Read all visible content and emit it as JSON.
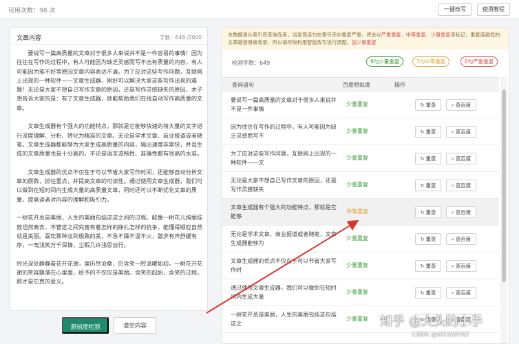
{
  "topbar": {
    "remaining": "可用次数：98 次",
    "rewrite": "一键改写",
    "tutorial": "使用教程"
  },
  "left": {
    "title": "文章内容",
    "count": "字数：649 /2000",
    "paragraphs": [
      "要说写一篇高质量的文章对于很多人来说并不是一件容易的事情！因为往往在写作的过程中，有人可能因为缺乏灵感而写不出有质量的内容，有人可能因为笔不好等原因文章内容表达不清。为了应对这些写作问题，互联网上出现的一种软件——文章生成器，刚好可以解决大家这些写作出现的难题！无论是大家不想自己写作文章的原因，还是写作灵感缺失的原因，木子想告诉大家的是：有了文章生成器，就能帮助我们在线自动写作高质量的文章。",
      "文章生成器有个强大的功能特点，那就是它能够快速的将大量的文字进行深度理解、分析、转化为精准的文章。无论是学术文章、商业报道或者随笔，文章生成器都能够为大家生成高质量的内容，输出速度非常快，并且生成的文章质量也是十分高的，不论是语言流畅性、准确性都有很高的水准。",
      "文章生成器的优点不仅在于可以节省大家写作时间，还能够自动分析文章的原数，抓住重点，并提高文章的可读性。通过使用文章生成器，我们可以做到在短时间内生成大量的高质量文章，同时还可以不断优化文章的质量，提高读者对内容的理解和吸引力。",
      "一树花开总是美丽，人生的美丽包括这这之间的过程。能像一树花儿绚丽绽放坦然离去，不管这之间究竟有着怎样的挣扎怎样的抗争，能懂得顺应自然就是美丽。喜欢那种淡到极致的美，不急不躁不温不火，散步有声舒缓有序，一弯浅笑万千深情，尘暇几许浅思淡行。",
      "时光深处静静看花开花谢，里历尽沧桑，仍含笑一腔温暖如初。一树花开花谢的笑容飘落在心里面，给予的不仅仅是美丽。含笑的起始，含笑的过程，那才是它真的意义。"
    ],
    "detect_btn": "原创度检测",
    "clear_btn": "清空内容"
  },
  "right": {
    "notice_pre": "本数据是从索引库查询而来，当发现该句在索引库中重复严重，将会以",
    "notice_hl1": "严重重复、中等重复、少量重复",
    "notice_post": "来标记，重复度越低的文章越容易被收录，所以请尽快利用智能改写进行调整。",
    "notice_link": "加少量重复",
    "detect_count": "检测字数：649",
    "pill_green": "9句少量重复",
    "pill_orange": "3句中等重复",
    "pill_red": "0句严重重复",
    "headers": {
      "query": "查询语句",
      "similarity": "百度相似度",
      "ops": "操作"
    },
    "btn_recheck": "重查",
    "btn_baidu": "查百度",
    "rows": [
      {
        "text": "要说写一篇高质量的文章对于很多人来说并不是一件事情",
        "status": "少量重复",
        "level": "green"
      },
      {
        "text": "因为往往在写作的过程中，有人可能因为缺乏灵感而写不",
        "status": "少量重复",
        "level": "green"
      },
      {
        "text": "为了应对这些写作问题，互联网上出现的一种软件——文",
        "status": "少量重复",
        "level": "green"
      },
      {
        "text": "无论是大家不想自己写作文章的原因，还是写作灵感缺失",
        "status": "少量重复",
        "level": "green"
      },
      {
        "text": "文章生成器有个强大的功能特点，那就是它能够",
        "status": "中等重复",
        "level": "orange"
      },
      {
        "text": "无论是学术文章、商业报道或者随笔，文章生成器能够为",
        "status": "少量重复",
        "level": "green"
      },
      {
        "text": "文章生成器的优点不仅在于可以节省大家写作时",
        "status": "少量重复",
        "level": "green"
      },
      {
        "text": "通过使用文章生成器，我们可以做到在短时间内生成大量",
        "status": "少量重复",
        "level": "green"
      },
      {
        "text": "一树花开总是美丽，人生的美丽包括这包括这之",
        "status": "少量重复",
        "level": "green"
      }
    ]
  },
  "watermark": "知乎 @大头的小手",
  "csdn": "CSDN @dXrbWYLV",
  "colors": {
    "green": "#3a9b3a",
    "orange": "#e0a33b",
    "red": "#d9534f",
    "primary": "#1f8a70"
  },
  "icons": {
    "refresh": "refresh-icon",
    "search": "search-icon"
  }
}
